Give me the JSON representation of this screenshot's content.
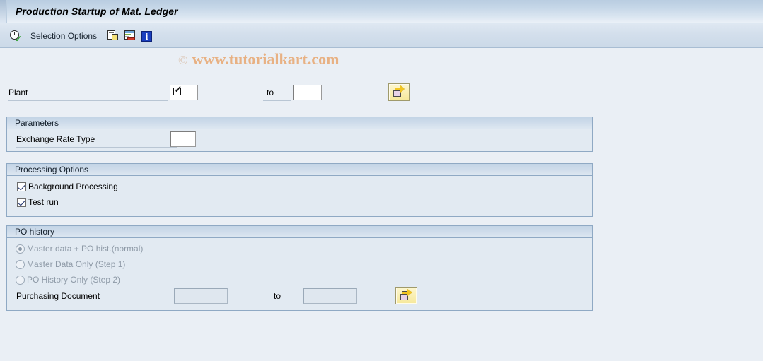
{
  "window": {
    "title": "Production Startup of Mat. Ledger"
  },
  "toolbar": {
    "execute_icon": "clock-check-icon",
    "selection_options_label": "Selection Options",
    "multiple_selection_icon": "multiple-selection-icon",
    "variant_icon": "get-variant-icon",
    "info_icon": "info-icon"
  },
  "watermark": {
    "copyright": "©",
    "text": "www.tutorialkart.com",
    "color": "#e8b183"
  },
  "selection": {
    "plant": {
      "label": "Plant",
      "value": "",
      "to_label": "to",
      "to_value": "",
      "multi_glyph": "checkbox-check-glyph",
      "multi_button_icon": "multiple-selection-arrow-icon"
    }
  },
  "parameters": {
    "title": "Parameters",
    "exchange_rate_type": {
      "label": "Exchange Rate Type",
      "value": ""
    }
  },
  "processing_options": {
    "title": "Processing Options",
    "items": [
      {
        "label": "Background Processing",
        "checked": true
      },
      {
        "label": "Test run",
        "checked": true
      }
    ]
  },
  "po_history": {
    "title": "PO history",
    "options": [
      {
        "label": "Master data + PO hist.(normal)",
        "selected": true
      },
      {
        "label": "Master Data Only (Step 1)",
        "selected": false
      },
      {
        "label": "PO History Only (Step 2)",
        "selected": false
      }
    ],
    "purchasing_document": {
      "label": "Purchasing Document",
      "value": "",
      "to_label": "to",
      "to_value": "",
      "multi_button_icon": "multiple-selection-arrow-icon"
    }
  },
  "colors": {
    "background": "#eaeff5",
    "group_border": "#8fa9c4",
    "title_gradient_top": "#b9cde1"
  }
}
